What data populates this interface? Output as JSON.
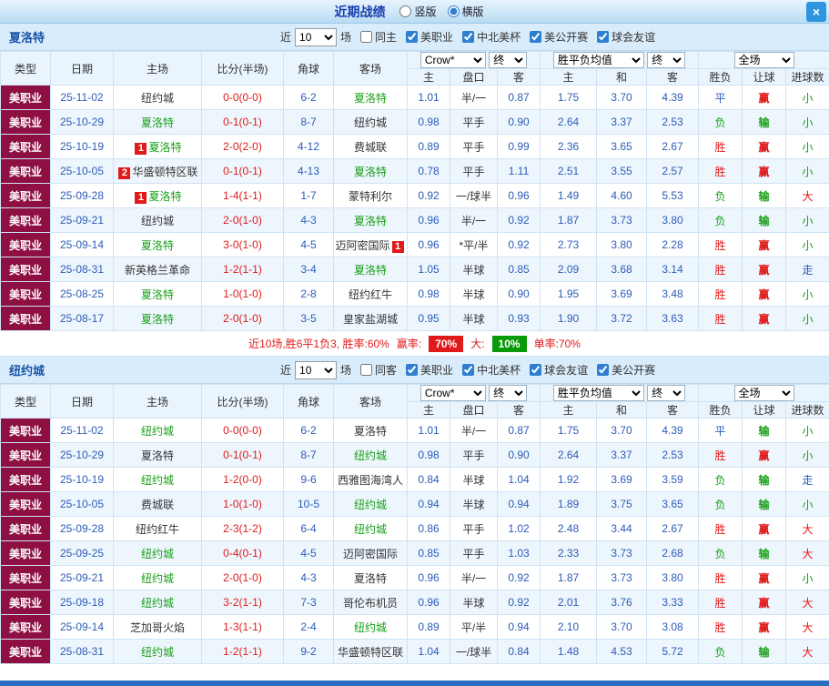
{
  "titlebar": {
    "title": "近期战绩",
    "radio_vertical": "竖版",
    "radio_horizontal": "横版",
    "close": "×"
  },
  "header": {
    "col_type": "类型",
    "col_date": "日期",
    "col_home": "主场",
    "col_score": "比分(半场)",
    "col_corner": "角球",
    "col_away": "客场",
    "dd_company": "Crow*",
    "dd_final1": "终",
    "dd_avg": "胜平负均值",
    "dd_final2": "终",
    "dd_scope": "全场",
    "sub": [
      "主",
      "盘口",
      "客",
      "主",
      "和",
      "客",
      "胜负",
      "让球",
      "进球数"
    ]
  },
  "sections": [
    {
      "team": "夏洛特",
      "near_label": "近",
      "near_value": "10",
      "games_label": "场",
      "same_label": "同主",
      "leagues": [
        "美职业",
        "中北美杯",
        "美公开赛",
        "球会友谊"
      ],
      "rows": [
        {
          "type": "美职业",
          "date": "25-11-02",
          "home": "纽约城",
          "score": "0-0(0-0)",
          "corner": "6-2",
          "away": "夏洛特",
          "odds": [
            "1.01",
            "半/一",
            "0.87"
          ],
          "avg": [
            "1.75",
            "3.70",
            "4.39"
          ],
          "res": [
            "平",
            "赢",
            "小"
          ]
        },
        {
          "type": "美职业",
          "date": "25-10-29",
          "home": "夏洛特",
          "score": "0-1(0-1)",
          "corner": "8-7",
          "away": "纽约城",
          "odds": [
            "0.98",
            "平手",
            "0.90"
          ],
          "avg": [
            "2.64",
            "3.37",
            "2.53"
          ],
          "res": [
            "负",
            "输",
            "小"
          ]
        },
        {
          "type": "美职业",
          "date": "25-10-19",
          "home": "夏洛特",
          "home_badge": "1",
          "score": "2-0(2-0)",
          "corner": "4-12",
          "away": "费城联",
          "odds": [
            "0.89",
            "平手",
            "0.99"
          ],
          "avg": [
            "2.36",
            "3.65",
            "2.67"
          ],
          "res": [
            "胜",
            "赢",
            "小"
          ]
        },
        {
          "type": "美职业",
          "date": "25-10-05",
          "home": "华盛顿特区联",
          "home_badge": "2",
          "score": "0-1(0-1)",
          "corner": "4-13",
          "away": "夏洛特",
          "odds": [
            "0.78",
            "平手",
            "1.11"
          ],
          "avg": [
            "2.51",
            "3.55",
            "2.57"
          ],
          "res": [
            "胜",
            "赢",
            "小"
          ]
        },
        {
          "type": "美职业",
          "date": "25-09-28",
          "home": "夏洛特",
          "home_badge": "1",
          "score": "1-4(1-1)",
          "corner": "1-7",
          "away": "蒙特利尔",
          "odds": [
            "0.92",
            "一/球半",
            "0.96"
          ],
          "avg": [
            "1.49",
            "4.60",
            "5.53"
          ],
          "res": [
            "负",
            "输",
            "大"
          ]
        },
        {
          "type": "美职业",
          "date": "25-09-21",
          "home": "纽约城",
          "score": "2-0(1-0)",
          "corner": "4-3",
          "away": "夏洛特",
          "odds": [
            "0.96",
            "半/一",
            "0.92"
          ],
          "avg": [
            "1.87",
            "3.73",
            "3.80"
          ],
          "res": [
            "负",
            "输",
            "小"
          ]
        },
        {
          "type": "美职业",
          "date": "25-09-14",
          "home": "夏洛特",
          "score": "3-0(1-0)",
          "corner": "4-5",
          "away": "迈阿密国际",
          "away_badge": "1",
          "odds": [
            "0.96",
            "*平/半",
            "0.92"
          ],
          "avg": [
            "2.73",
            "3.80",
            "2.28"
          ],
          "res": [
            "胜",
            "赢",
            "小"
          ]
        },
        {
          "type": "美职业",
          "date": "25-08-31",
          "home": "新英格兰革命",
          "score": "1-2(1-1)",
          "corner": "3-4",
          "away": "夏洛特",
          "odds": [
            "1.05",
            "半球",
            "0.85"
          ],
          "avg": [
            "2.09",
            "3.68",
            "3.14"
          ],
          "res": [
            "胜",
            "赢",
            "走"
          ]
        },
        {
          "type": "美职业",
          "date": "25-08-25",
          "home": "夏洛特",
          "score": "1-0(1-0)",
          "corner": "2-8",
          "away": "纽约红牛",
          "odds": [
            "0.98",
            "半球",
            "0.90"
          ],
          "avg": [
            "1.95",
            "3.69",
            "3.48"
          ],
          "res": [
            "胜",
            "赢",
            "小"
          ]
        },
        {
          "type": "美职业",
          "date": "25-08-17",
          "home": "夏洛特",
          "score": "2-0(1-0)",
          "corner": "3-5",
          "away": "皇家盐湖城",
          "odds": [
            "0.95",
            "半球",
            "0.93"
          ],
          "avg": [
            "1.90",
            "3.72",
            "3.63"
          ],
          "res": [
            "胜",
            "赢",
            "小"
          ]
        }
      ],
      "summary": {
        "text": "近10场,胜6平1负3, 胜率:60%",
        "win_label": "赢率:",
        "win_value": "70%",
        "big_label": "大:",
        "big_value": "10%",
        "single_text": "单率:70%"
      }
    },
    {
      "team": "纽约城",
      "near_label": "近",
      "near_value": "10",
      "games_label": "场",
      "same_label": "同客",
      "leagues": [
        "美职业",
        "中北美杯",
        "球会友谊",
        "美公开赛"
      ],
      "rows": [
        {
          "type": "美职业",
          "date": "25-11-02",
          "home": "纽约城",
          "score": "0-0(0-0)",
          "corner": "6-2",
          "away": "夏洛特",
          "odds": [
            "1.01",
            "半/一",
            "0.87"
          ],
          "avg": [
            "1.75",
            "3.70",
            "4.39"
          ],
          "res": [
            "平",
            "输",
            "小"
          ]
        },
        {
          "type": "美职业",
          "date": "25-10-29",
          "home": "夏洛特",
          "score": "0-1(0-1)",
          "corner": "8-7",
          "away": "纽约城",
          "odds": [
            "0.98",
            "平手",
            "0.90"
          ],
          "avg": [
            "2.64",
            "3.37",
            "2.53"
          ],
          "res": [
            "胜",
            "赢",
            "小"
          ]
        },
        {
          "type": "美职业",
          "date": "25-10-19",
          "home": "纽约城",
          "score": "1-2(0-0)",
          "corner": "9-6",
          "away": "西雅图海湾人",
          "odds": [
            "0.84",
            "半球",
            "1.04"
          ],
          "avg": [
            "1.92",
            "3.69",
            "3.59"
          ],
          "res": [
            "负",
            "输",
            "走"
          ]
        },
        {
          "type": "美职业",
          "date": "25-10-05",
          "home": "费城联",
          "score": "1-0(1-0)",
          "corner": "10-5",
          "away": "纽约城",
          "odds": [
            "0.94",
            "半球",
            "0.94"
          ],
          "avg": [
            "1.89",
            "3.75",
            "3.65"
          ],
          "res": [
            "负",
            "输",
            "小"
          ]
        },
        {
          "type": "美职业",
          "date": "25-09-28",
          "home": "纽约红牛",
          "score": "2-3(1-2)",
          "corner": "6-4",
          "away": "纽约城",
          "odds": [
            "0.86",
            "平手",
            "1.02"
          ],
          "avg": [
            "2.48",
            "3.44",
            "2.67"
          ],
          "res": [
            "胜",
            "赢",
            "大"
          ]
        },
        {
          "type": "美职业",
          "date": "25-09-25",
          "home": "纽约城",
          "score": "0-4(0-1)",
          "corner": "4-5",
          "away": "迈阿密国际",
          "odds": [
            "0.85",
            "平手",
            "1.03"
          ],
          "avg": [
            "2.33",
            "3.73",
            "2.68"
          ],
          "res": [
            "负",
            "输",
            "大"
          ]
        },
        {
          "type": "美职业",
          "date": "25-09-21",
          "home": "纽约城",
          "score": "2-0(1-0)",
          "corner": "4-3",
          "away": "夏洛特",
          "odds": [
            "0.96",
            "半/一",
            "0.92"
          ],
          "avg": [
            "1.87",
            "3.73",
            "3.80"
          ],
          "res": [
            "胜",
            "赢",
            "小"
          ]
        },
        {
          "type": "美职业",
          "date": "25-09-18",
          "home": "纽约城",
          "score": "3-2(1-1)",
          "corner": "7-3",
          "away": "哥伦布机员",
          "odds": [
            "0.96",
            "半球",
            "0.92"
          ],
          "avg": [
            "2.01",
            "3.76",
            "3.33"
          ],
          "res": [
            "胜",
            "赢",
            "大"
          ]
        },
        {
          "type": "美职业",
          "date": "25-09-14",
          "home": "芝加哥火焰",
          "score": "1-3(1-1)",
          "corner": "2-4",
          "away": "纽约城",
          "odds": [
            "0.89",
            "平/半",
            "0.94"
          ],
          "avg": [
            "2.10",
            "3.70",
            "3.08"
          ],
          "res": [
            "胜",
            "赢",
            "大"
          ]
        },
        {
          "type": "美职业",
          "date": "25-08-31",
          "home": "纽约城",
          "score": "1-2(1-1)",
          "corner": "9-2",
          "away": "华盛顿特区联",
          "odds": [
            "1.04",
            "一/球半",
            "0.84"
          ],
          "avg": [
            "1.48",
            "4.53",
            "5.72"
          ],
          "res": [
            "负",
            "输",
            "大"
          ]
        }
      ]
    }
  ]
}
